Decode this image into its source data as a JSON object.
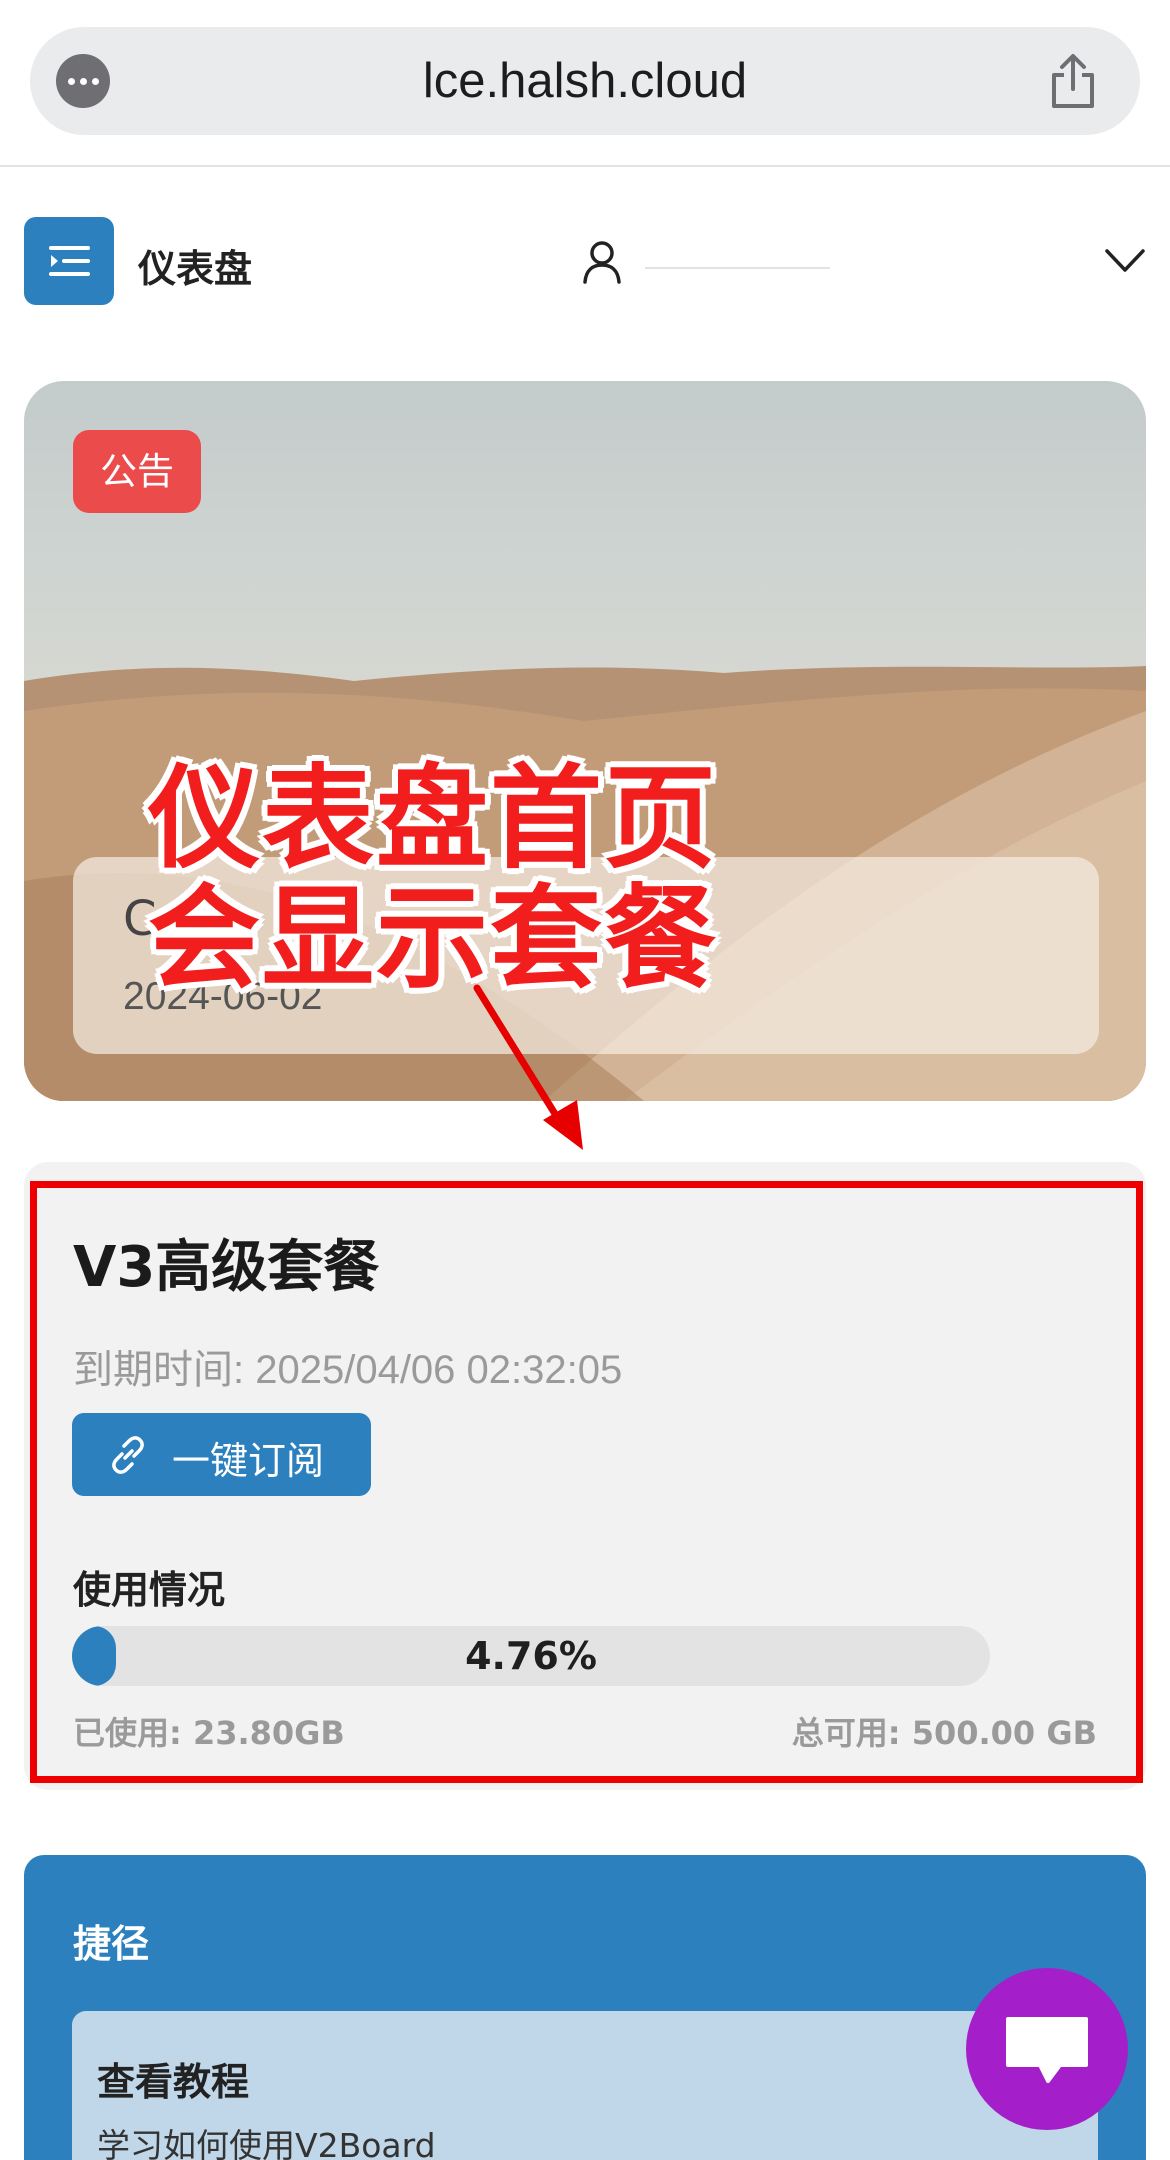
{
  "browser": {
    "url": "lce.halsh.cloud",
    "icons": {
      "more": "more-icon",
      "share": "share-icon"
    }
  },
  "header": {
    "title": "仪表盘",
    "icons": {
      "menu": "menu-collapse-icon",
      "user": "user-icon",
      "dropdown": "chevron-down-icon"
    }
  },
  "notice": {
    "badge": "公告",
    "title": "C",
    "date": "2024-06-02"
  },
  "overlay": {
    "line1": "仪表盘首页",
    "line2": "会显示套餐",
    "color": "#f21e1e"
  },
  "plan": {
    "name": "V3高级套餐",
    "expiry": "到期时间: 2025/04/06 02:32:05",
    "subscribe_label": "一键订阅",
    "usage_title": "使用情况",
    "usage_percent": 4.76,
    "usage_percent_label": "4.76%",
    "used": "已使用: 23.80GB",
    "total": "总可用: 500.00 GB"
  },
  "shortcuts": {
    "title": "捷径",
    "items": [
      {
        "title": "查看教程",
        "desc": "学习如何使用V2Board"
      }
    ]
  },
  "colors": {
    "primary": "#2b80bd",
    "badge": "#ec4b4b",
    "chat": "#a41fc9",
    "highlight": "#ee0000"
  }
}
